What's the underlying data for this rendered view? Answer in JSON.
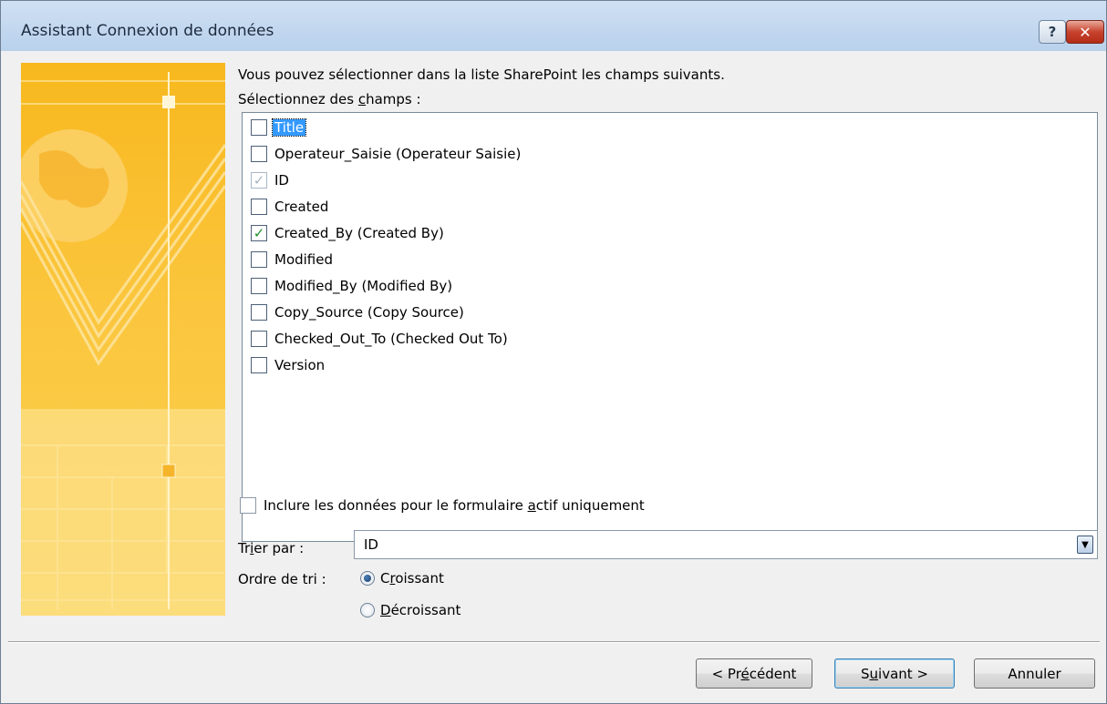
{
  "window": {
    "title": "Assistant Connexion de données",
    "help_label": "?",
    "close_label": "✕"
  },
  "content": {
    "intro": "Vous pouvez sélectionner dans la liste SharePoint les champs suivants.",
    "fields_label": "Sélectionnez des champs :",
    "fields": [
      {
        "label": "Title",
        "checked": false,
        "disabled": false,
        "highlighted": true
      },
      {
        "label": "Operateur_Saisie (Operateur Saisie)",
        "checked": false,
        "disabled": false,
        "highlighted": false
      },
      {
        "label": "ID",
        "checked": true,
        "disabled": true,
        "highlighted": false
      },
      {
        "label": "Created",
        "checked": false,
        "disabled": false,
        "highlighted": false
      },
      {
        "label": "Created_By (Created By)",
        "checked": true,
        "disabled": false,
        "highlighted": false
      },
      {
        "label": "Modified",
        "checked": false,
        "disabled": false,
        "highlighted": false
      },
      {
        "label": "Modified_By (Modified By)",
        "checked": false,
        "disabled": false,
        "highlighted": false
      },
      {
        "label": "Copy_Source (Copy Source)",
        "checked": false,
        "disabled": false,
        "highlighted": false
      },
      {
        "label": "Checked_Out_To (Checked Out To)",
        "checked": false,
        "disabled": false,
        "highlighted": false
      },
      {
        "label": "Version",
        "checked": false,
        "disabled": false,
        "highlighted": false
      }
    ],
    "include_active_only": {
      "label": "Inclure les données pour le formulaire actif uniquement",
      "checked": false
    },
    "sort": {
      "label": "Trier par :",
      "value": "ID"
    },
    "order": {
      "label": "Ordre de tri :",
      "options": [
        {
          "label": "Croissant",
          "selected": true
        },
        {
          "label": "Décroissant",
          "selected": false
        }
      ]
    }
  },
  "buttons": {
    "back": "< Précédent",
    "next": "Suivant >",
    "cancel": "Annuler"
  },
  "colors": {
    "banner_primary": "#f8b81e",
    "banner_light": "#fde58c",
    "selection_highlight": "#3399ff",
    "check_green": "#1e8f2a",
    "close_red": "#c7432e"
  }
}
